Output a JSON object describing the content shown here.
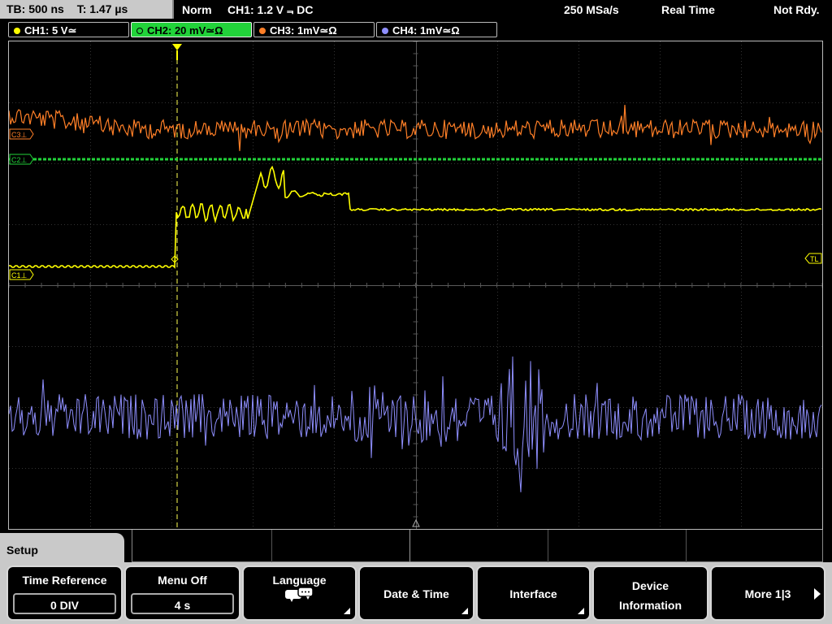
{
  "status_bar": {
    "timebase": "TB: 500 ns",
    "trigger_time": "T: 1.47 µs",
    "acq_mode": "Norm",
    "trigger_info": "CH1: 1.2 V ⫬ DC",
    "sample_rate": "250 MSa/s",
    "display_mode": "Real Time",
    "status": "Not Rdy."
  },
  "channels": [
    {
      "label": "CH1: 5 V≃",
      "color": "#ffff00",
      "active": false
    },
    {
      "label": "CH2: 20 mV≃Ω",
      "color": "#22d33a",
      "active": true
    },
    {
      "label": "CH3: 1mV≃Ω",
      "color": "#ff7f27",
      "active": false
    },
    {
      "label": "CH4: 1mV≃Ω",
      "color": "#8f8fff",
      "active": false
    }
  ],
  "markers": {
    "c3": "C3⊥",
    "c2": "C2⊥",
    "c1": "C1⊥",
    "trigger_level": "TL"
  },
  "menu": {
    "title": "Setup",
    "softkeys": [
      {
        "label": "Time Reference",
        "value": "0 DIV"
      },
      {
        "label": "Menu Off",
        "value": "4 s"
      },
      {
        "label": "Language",
        "icon": "speech-bubbles-icon"
      },
      {
        "label": "Date & Time"
      },
      {
        "label": "Interface"
      },
      {
        "label": "Device",
        "label2": "Information"
      },
      {
        "label": "More 1|3",
        "icon": "right-arrow-icon"
      }
    ]
  }
}
